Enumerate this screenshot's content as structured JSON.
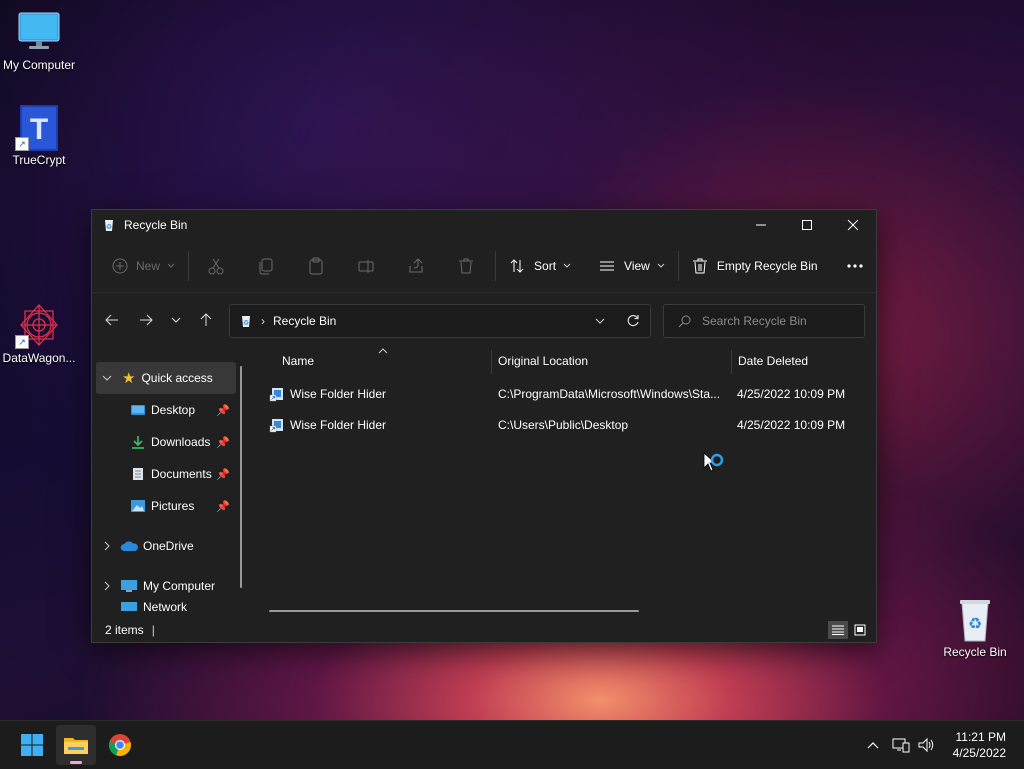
{
  "desktop": {
    "icons": [
      {
        "label": "My Computer"
      },
      {
        "label": "TrueCrypt"
      },
      {
        "label": "DataWagon..."
      },
      {
        "label": "Recycle Bin"
      }
    ]
  },
  "window": {
    "title": "Recycle Bin",
    "toolbar": {
      "new_label": "New",
      "sort_label": "Sort",
      "view_label": "View",
      "empty_label": "Empty Recycle Bin"
    },
    "address": {
      "path": "Recycle Bin"
    },
    "search": {
      "placeholder": "Search Recycle Bin"
    },
    "sidebar": {
      "items": [
        {
          "label": "Quick access"
        },
        {
          "label": "Desktop"
        },
        {
          "label": "Downloads"
        },
        {
          "label": "Documents"
        },
        {
          "label": "Pictures"
        },
        {
          "label": "OneDrive"
        },
        {
          "label": "My Computer"
        },
        {
          "label": "Network"
        }
      ]
    },
    "columns": {
      "name": "Name",
      "original_location": "Original Location",
      "date_deleted": "Date Deleted"
    },
    "files": [
      {
        "name": "Wise Folder Hider",
        "location": "C:\\ProgramData\\Microsoft\\Windows\\Sta...",
        "date": "4/25/2022 10:09 PM"
      },
      {
        "name": "Wise Folder Hider",
        "location": "C:\\Users\\Public\\Desktop",
        "date": "4/25/2022 10:09 PM"
      }
    ],
    "status": {
      "count": "2 items"
    }
  },
  "taskbar": {
    "clock": {
      "time": "11:21 PM",
      "date": "4/25/2022"
    }
  },
  "colors": {
    "accent": "#0078d4",
    "window_bg": "#202020",
    "taskbar_bg": "#1c1c1c"
  }
}
